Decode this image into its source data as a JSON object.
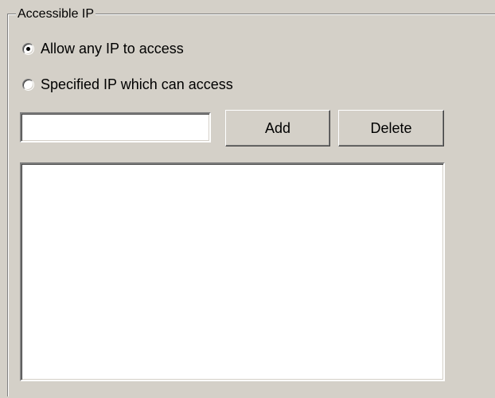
{
  "group": {
    "title": "Accessible IP"
  },
  "options": {
    "allow_any": {
      "label": "Allow any IP to access",
      "checked": true
    },
    "specified": {
      "label": "Specified IP which can access",
      "checked": false
    }
  },
  "ip_input": {
    "value": "",
    "placeholder": ""
  },
  "buttons": {
    "add_label": "Add",
    "delete_label": "Delete"
  },
  "ip_list": {
    "items": []
  },
  "colors": {
    "background": "#d4d0c8",
    "field": "#ffffff",
    "shadow": "#808080",
    "highlight": "#ffffff",
    "dark_shadow": "#404040"
  }
}
